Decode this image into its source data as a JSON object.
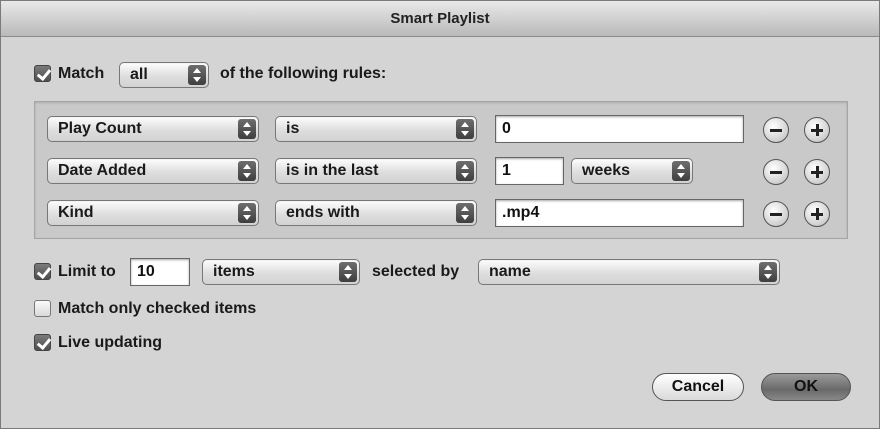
{
  "window": {
    "title": "Smart Playlist"
  },
  "match": {
    "checked": true,
    "label": "Match",
    "mode": "all",
    "suffix": "of the following rules:"
  },
  "rules": [
    {
      "field": "Play Count",
      "operator": "is",
      "value": "0",
      "unit": ""
    },
    {
      "field": "Date Added",
      "operator": "is in the last",
      "value": "1",
      "unit": "weeks"
    },
    {
      "field": "Kind",
      "operator": "ends with",
      "value": ".mp4",
      "unit": ""
    }
  ],
  "limit": {
    "checked": true,
    "label": "Limit to",
    "value": "10",
    "unit": "items",
    "selected_by_label": "selected by",
    "selected_by": "name"
  },
  "match_only_checked": {
    "checked": false,
    "label": "Match only checked items"
  },
  "live_updating": {
    "checked": true,
    "label": "Live updating"
  },
  "buttons": {
    "cancel": "Cancel",
    "ok": "OK"
  },
  "icons": {
    "remove": "minus-circle-icon",
    "add": "plus-circle-icon",
    "popup": "updown-arrows-icon",
    "check": "checkmark-icon"
  }
}
